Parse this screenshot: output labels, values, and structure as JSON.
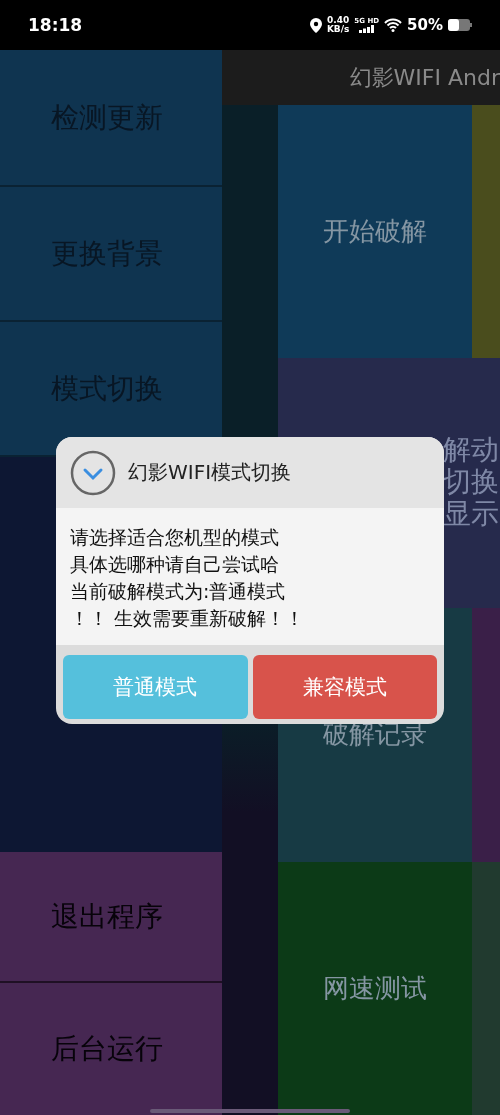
{
  "status_bar": {
    "time": "18:18",
    "net_speed": "0.40",
    "net_unit": "KB/s",
    "network": "5G HD",
    "battery": "50%"
  },
  "drawer": {
    "top_items": [
      {
        "label": "检测更新"
      },
      {
        "label": "更换背景"
      },
      {
        "label": "模式切换"
      }
    ],
    "bottom_items": [
      {
        "label": "退出程序"
      },
      {
        "label": "后台运行"
      }
    ]
  },
  "app_title": "幻影WIFI Andr",
  "tiles": [
    {
      "kind": "full",
      "lines": [
        "开始破解"
      ],
      "color": "#0f3a58"
    },
    {
      "kind": "cut",
      "lines": [
        "解动",
        "切换",
        "显示"
      ],
      "color": "#262a4c"
    },
    {
      "kind": "full",
      "lines": [
        "破解记录"
      ],
      "color": "#173a44"
    },
    {
      "kind": "full",
      "lines": [
        "网速测试"
      ],
      "color": "#0c3a17"
    }
  ],
  "dialog": {
    "title": "幻影WIFI模式切换",
    "message": [
      "请选择适合您机型的模式",
      "具体选哪种请自己尝试哈",
      "当前破解模式为:普通模式",
      "！！ 生效需要重新破解！！"
    ],
    "buttons": [
      {
        "label": "普通模式",
        "kind": "info"
      },
      {
        "label": "兼容模式",
        "kind": "danger"
      }
    ]
  }
}
